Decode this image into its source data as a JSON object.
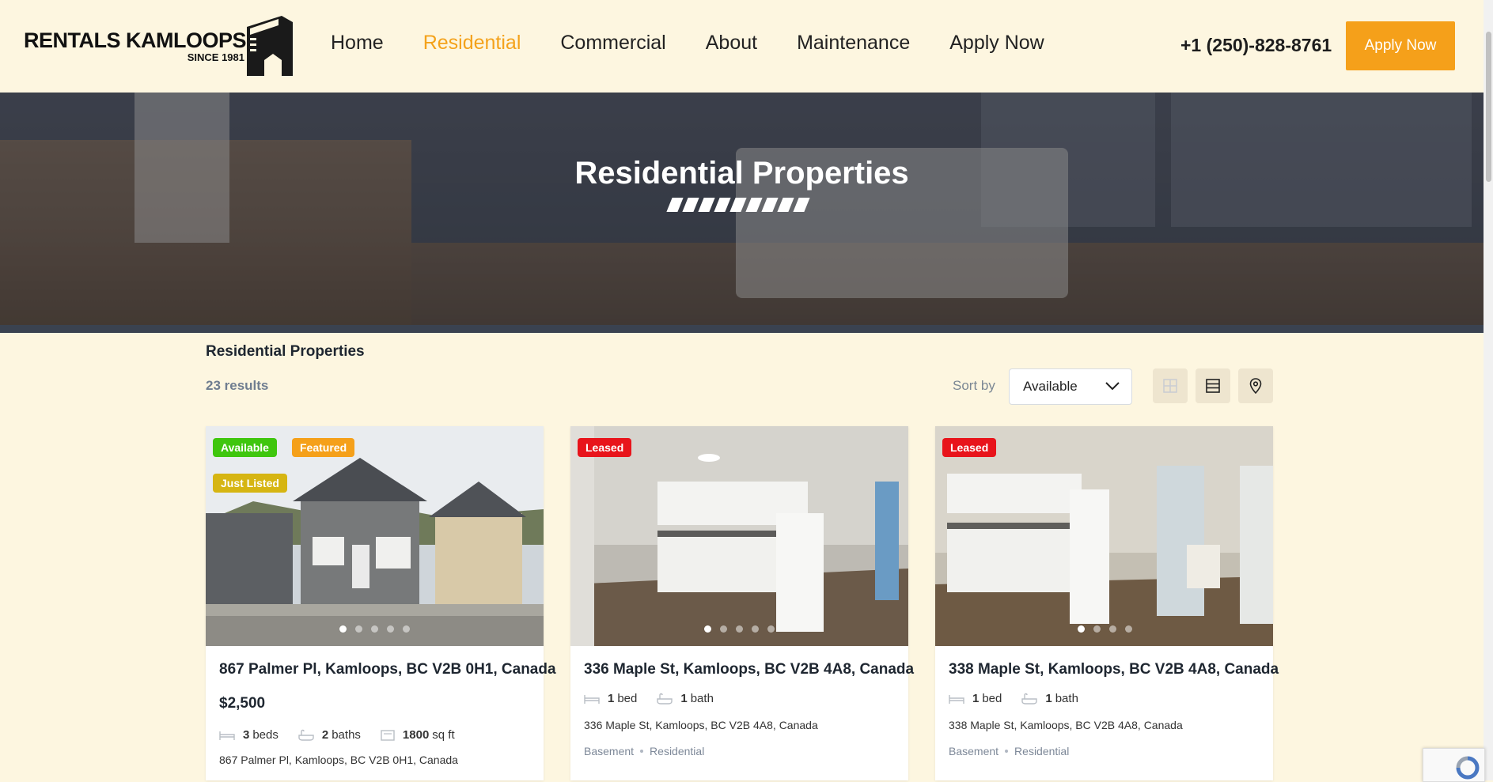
{
  "header": {
    "logo_text": "RENTALS KAMLOOPS",
    "logo_sub": "SINCE 1981",
    "nav": [
      {
        "label": "Home"
      },
      {
        "label": "Residential"
      },
      {
        "label": "Commercial"
      },
      {
        "label": "About"
      },
      {
        "label": "Maintenance"
      },
      {
        "label": "Apply Now"
      }
    ],
    "active_nav": "Residential",
    "phone": "+1 (250)-828-8761",
    "apply_button": "Apply Now",
    "accent_color": "#f5a01a"
  },
  "hero": {
    "title": "Residential Properties"
  },
  "listing": {
    "title": "Residential Properties",
    "results": "23 results",
    "sort_label": "Sort by",
    "sort_value": "Available",
    "views": [
      "grid-view-icon",
      "list-view-icon",
      "map-view-icon"
    ]
  },
  "cards": [
    {
      "badges": [
        "Available",
        "Featured",
        "Just Listed"
      ],
      "title": "867 Palmer Pl, Kamloops, BC V2B 0H1, Canada",
      "price": "$2,500",
      "beds": "3",
      "beds_label": "beds",
      "baths": "2",
      "baths_label": "baths",
      "area": "1800",
      "area_label": "sq ft",
      "address": "867 Palmer Pl, Kamloops, BC V2B 0H1, Canada",
      "slides": 5,
      "active_slide": 1
    },
    {
      "badges": [
        "Leased"
      ],
      "title": "336 Maple St, Kamloops, BC V2B 4A8, Canada",
      "beds": "1",
      "beds_label": "bed",
      "baths": "1",
      "baths_label": "bath",
      "address": "336 Maple St, Kamloops, BC V2B 4A8, Canada",
      "tags": [
        "Basement",
        "Residential"
      ],
      "slides": 5,
      "active_slide": 1
    },
    {
      "badges": [
        "Leased"
      ],
      "title": "338 Maple St, Kamloops, BC V2B 4A8, Canada",
      "beds": "1",
      "beds_label": "bed",
      "baths": "1",
      "baths_label": "bath",
      "address": "338 Maple St, Kamloops, BC V2B 4A8, Canada",
      "tags": [
        "Basement",
        "Residential"
      ],
      "slides": 4,
      "active_slide": 1
    }
  ],
  "badge_colors": {
    "Available": "#3fc60e",
    "Featured": "#f5a01a",
    "Just Listed": "#d6b512",
    "Leased": "#e8141b"
  }
}
